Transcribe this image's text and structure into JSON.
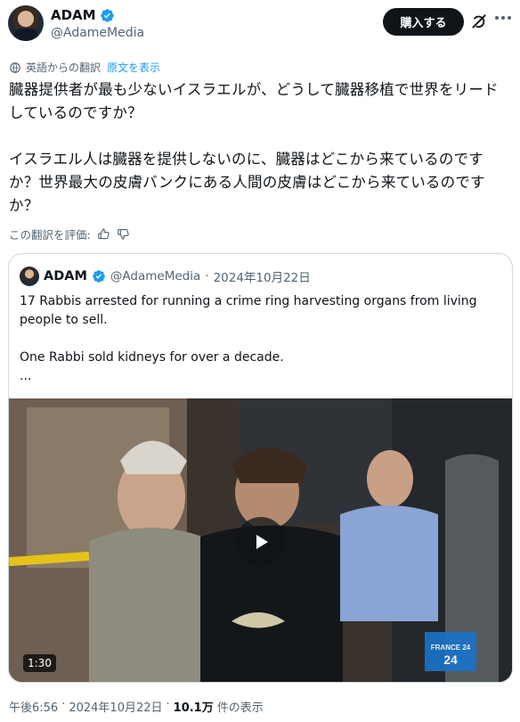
{
  "author": {
    "name": "ADAM",
    "handle": "@AdameMedia"
  },
  "header": {
    "buy_label": "購入する"
  },
  "translation": {
    "label": "英語からの翻訳",
    "show_original": "原文を表示"
  },
  "tweet": {
    "paragraphs": [
      "臓器提供者が最も少ないイスラエルが、どうして臓器移植で世界をリードしているのですか？",
      "イスラエル人は臓器を提供しないのに、臓器はどこから来ているのですか？世界最大の皮膚バンクにある人間の皮膚はどこから来ているのですか？"
    ]
  },
  "rating": {
    "label": "この翻訳を評価:"
  },
  "quote": {
    "name": "ADAM",
    "handle": "@AdameMedia",
    "separator": "·",
    "date": "2024年10月22日",
    "paragraphs": [
      "17 Rabbis arrested for running a crime ring harvesting organs from living people to sell.",
      "One Rabbi sold kidneys for over a decade.",
      "..."
    ],
    "video": {
      "duration": "1:30",
      "watermark_text": "FRANCE 24"
    }
  },
  "footer": {
    "time": "午後6:56",
    "separator": "·",
    "date": "2024年10月22日",
    "views_count": "10.1万",
    "views_label": "件の表示"
  },
  "colors": {
    "accent": "#1d9bf0",
    "text": "#0f1419",
    "muted": "#536471",
    "border": "#cfd9de"
  },
  "icons": [
    "verified-badge-icon",
    "grok-icon",
    "more-icon",
    "translate-icon",
    "thumbs-up-icon",
    "thumbs-down-icon",
    "play-icon"
  ]
}
